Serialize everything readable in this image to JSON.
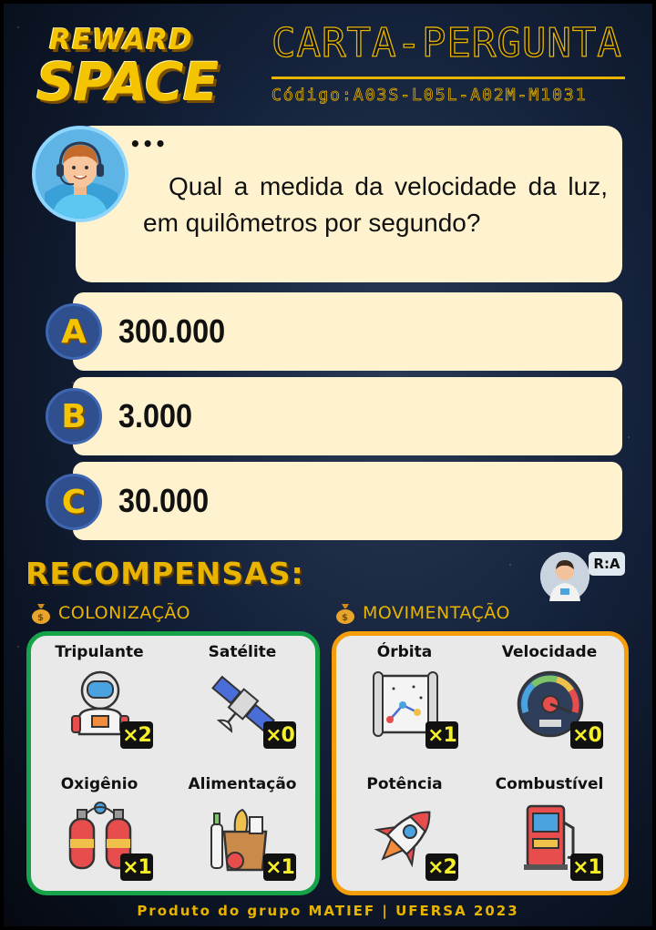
{
  "logo": {
    "line1": "REWARD",
    "line2": "SPACE"
  },
  "header": {
    "title": "CARTA-PERGUNTA",
    "code": "Código:A03S-L05L-A02M-M1031"
  },
  "question": {
    "dots": "•••",
    "text": "Qual a medida da velocidade da luz, em quilômetros por segundo?"
  },
  "options": [
    {
      "letter": "A",
      "text": "300.000"
    },
    {
      "letter": "B",
      "text": "3.000"
    },
    {
      "letter": "C",
      "text": "30.000"
    }
  ],
  "rewards": {
    "title": "RECOMPENSAS:",
    "answer_tag": "R:A",
    "colonizacao": {
      "label": "COLONIZAÇÃO",
      "items": [
        {
          "label": "Tripulante",
          "mult": "×2",
          "icon": "astronaut-icon"
        },
        {
          "label": "Satélite",
          "mult": "×0",
          "icon": "satellite-icon"
        },
        {
          "label": "Oxigênio",
          "mult": "×1",
          "icon": "oxygen-tank-icon"
        },
        {
          "label": "Alimentação",
          "mult": "×1",
          "icon": "food-bag-icon"
        }
      ]
    },
    "movimentacao": {
      "label": "MOVIMENTAÇÃO",
      "items": [
        {
          "label": "Órbita",
          "mult": "×1",
          "icon": "orbit-map-icon"
        },
        {
          "label": "Velocidade",
          "mult": "×0",
          "icon": "speedometer-icon"
        },
        {
          "label": "Potência",
          "mult": "×2",
          "icon": "rocket-icon"
        },
        {
          "label": "Combustível",
          "mult": "×1",
          "icon": "fuel-pump-icon"
        }
      ]
    }
  },
  "footer": "Produto do grupo MATIEF | UFERSA 2023",
  "colors": {
    "gold": "#e8b400",
    "cream": "#fff3cf",
    "green": "#16a34a",
    "orange": "#f59e0b"
  }
}
